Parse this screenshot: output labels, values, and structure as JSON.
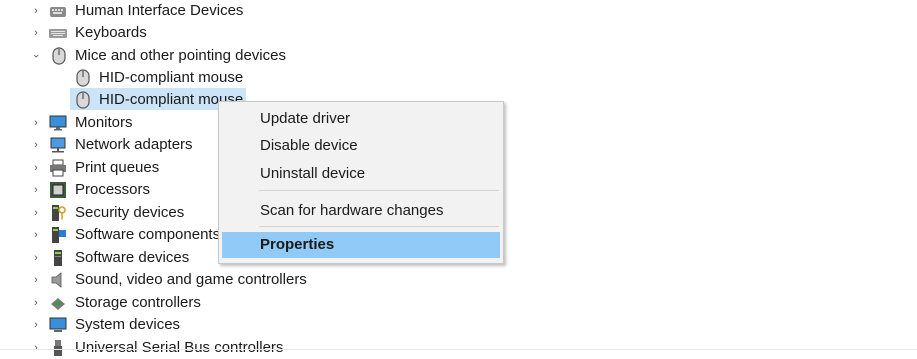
{
  "tree": {
    "items": [
      {
        "label": "Human Interface Devices",
        "icon": "hid-icon",
        "expanded": false
      },
      {
        "label": "Keyboards",
        "icon": "keyboard-icon",
        "expanded": false
      },
      {
        "label": "Mice and other pointing devices",
        "icon": "mouse-icon",
        "expanded": true
      },
      {
        "label": "HID-compliant mouse",
        "icon": "mouse-icon"
      },
      {
        "label": "HID-compliant mouse",
        "icon": "mouse-icon",
        "selected": true
      },
      {
        "label": "Monitors",
        "icon": "monitor-icon",
        "expanded": false
      },
      {
        "label": "Network adapters",
        "icon": "network-adapter-icon",
        "expanded": false
      },
      {
        "label": "Print queues",
        "icon": "printer-icon",
        "expanded": false
      },
      {
        "label": "Processors",
        "icon": "processor-icon",
        "expanded": false
      },
      {
        "label": "Security devices",
        "icon": "security-device-icon",
        "expanded": false
      },
      {
        "label": "Software components",
        "icon": "software-component-icon",
        "expanded": false
      },
      {
        "label": "Software devices",
        "icon": "software-device-icon",
        "expanded": false
      },
      {
        "label": "Sound, video and game controllers",
        "icon": "speaker-icon",
        "expanded": false
      },
      {
        "label": "Storage controllers",
        "icon": "storage-controller-icon",
        "expanded": false
      },
      {
        "label": "System devices",
        "icon": "system-device-icon",
        "expanded": false
      },
      {
        "label": "Universal Serial Bus controllers",
        "icon": "usb-icon",
        "expanded": false
      }
    ]
  },
  "context_menu": {
    "items": {
      "update_driver": "Update driver",
      "disable_device": "Disable device",
      "uninstall_device": "Uninstall device",
      "scan": "Scan for hardware changes",
      "properties": "Properties"
    },
    "highlighted": "Properties"
  },
  "colors": {
    "selection": "#cce4f7",
    "menu_highlight": "#91c9f7",
    "menu_background": "#f2f2f2"
  }
}
